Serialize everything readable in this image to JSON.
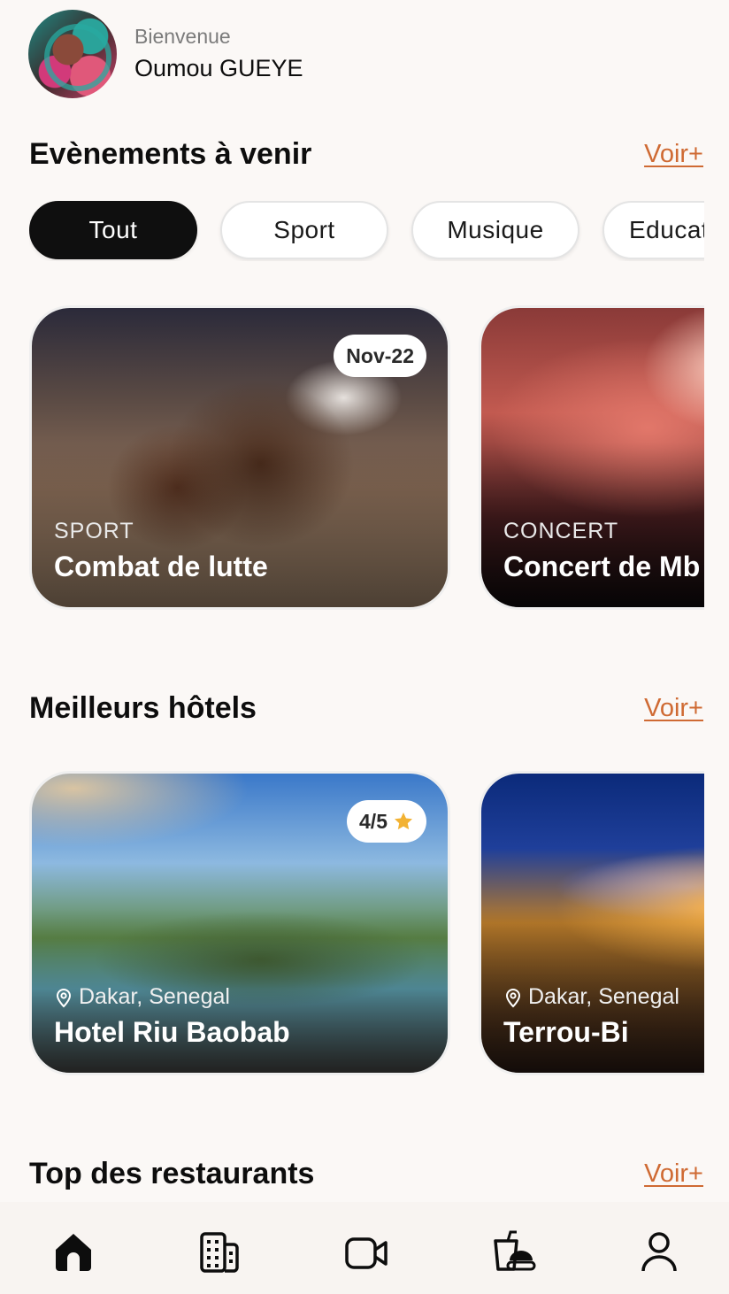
{
  "header": {
    "greeting": "Bienvenue",
    "user_name": "Oumou GUEYE"
  },
  "events": {
    "title": "Evènements à venir",
    "see_more": "Voir+",
    "filters": [
      "Tout",
      "Sport",
      "Musique",
      "Educat"
    ],
    "active_filter": "Tout",
    "cards": [
      {
        "category": "SPORT",
        "name": "Combat de lutte",
        "date": "Nov-22"
      },
      {
        "category": "CONCERT",
        "name": "Concert de Mb"
      }
    ]
  },
  "hotels": {
    "title": "Meilleurs hôtels",
    "see_more": "Voir+",
    "cards": [
      {
        "location": "Dakar, Senegal",
        "name": "Hotel Riu Baobab",
        "rating": "4/5"
      },
      {
        "location": "Dakar, Senegal",
        "name": "Terrou-Bi"
      }
    ]
  },
  "restaurants": {
    "title": "Top des restaurants",
    "see_more": "Voir+"
  },
  "bottom_nav": {
    "items": [
      "home-icon",
      "hotel-building-icon",
      "video-camera-icon",
      "food-drink-icon",
      "profile-icon"
    ],
    "active": "home-icon"
  },
  "colors": {
    "accent": "#cf6a33",
    "background": "#fbf8f6",
    "star": "#f2b233"
  }
}
